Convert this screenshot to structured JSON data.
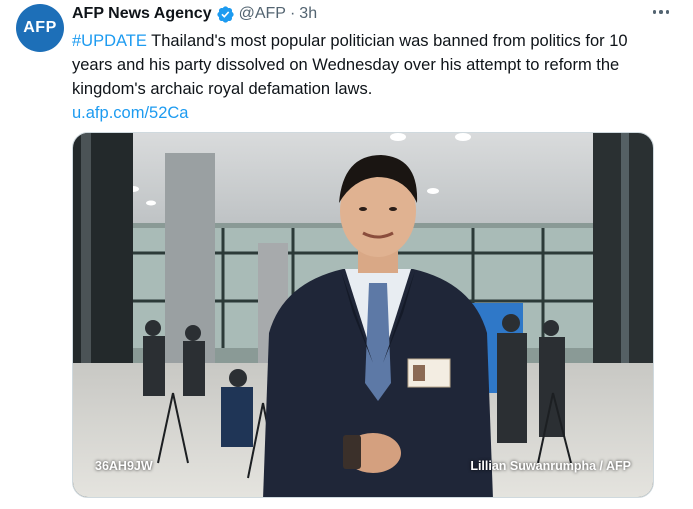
{
  "tweet": {
    "avatar_text": "AFP",
    "author_name": "AFP News Agency",
    "handle": "@AFP",
    "separator": "·",
    "time": "3h",
    "hashtag": "#UPDATE",
    "body": " Thailand's most popular politician was banned from politics for 10 years and his party dissolved on Wednesday over his attempt to reform the kingdom's archaic royal defamation laws.",
    "link": "u.afp.com/52Ca"
  },
  "media": {
    "photo_code": "36AH9JW",
    "credit": "Lillian Suwanrumpha / AFP"
  },
  "colors": {
    "brand": "#1d6fb8",
    "link": "#1d9bf0",
    "secondary_text": "#536471"
  }
}
